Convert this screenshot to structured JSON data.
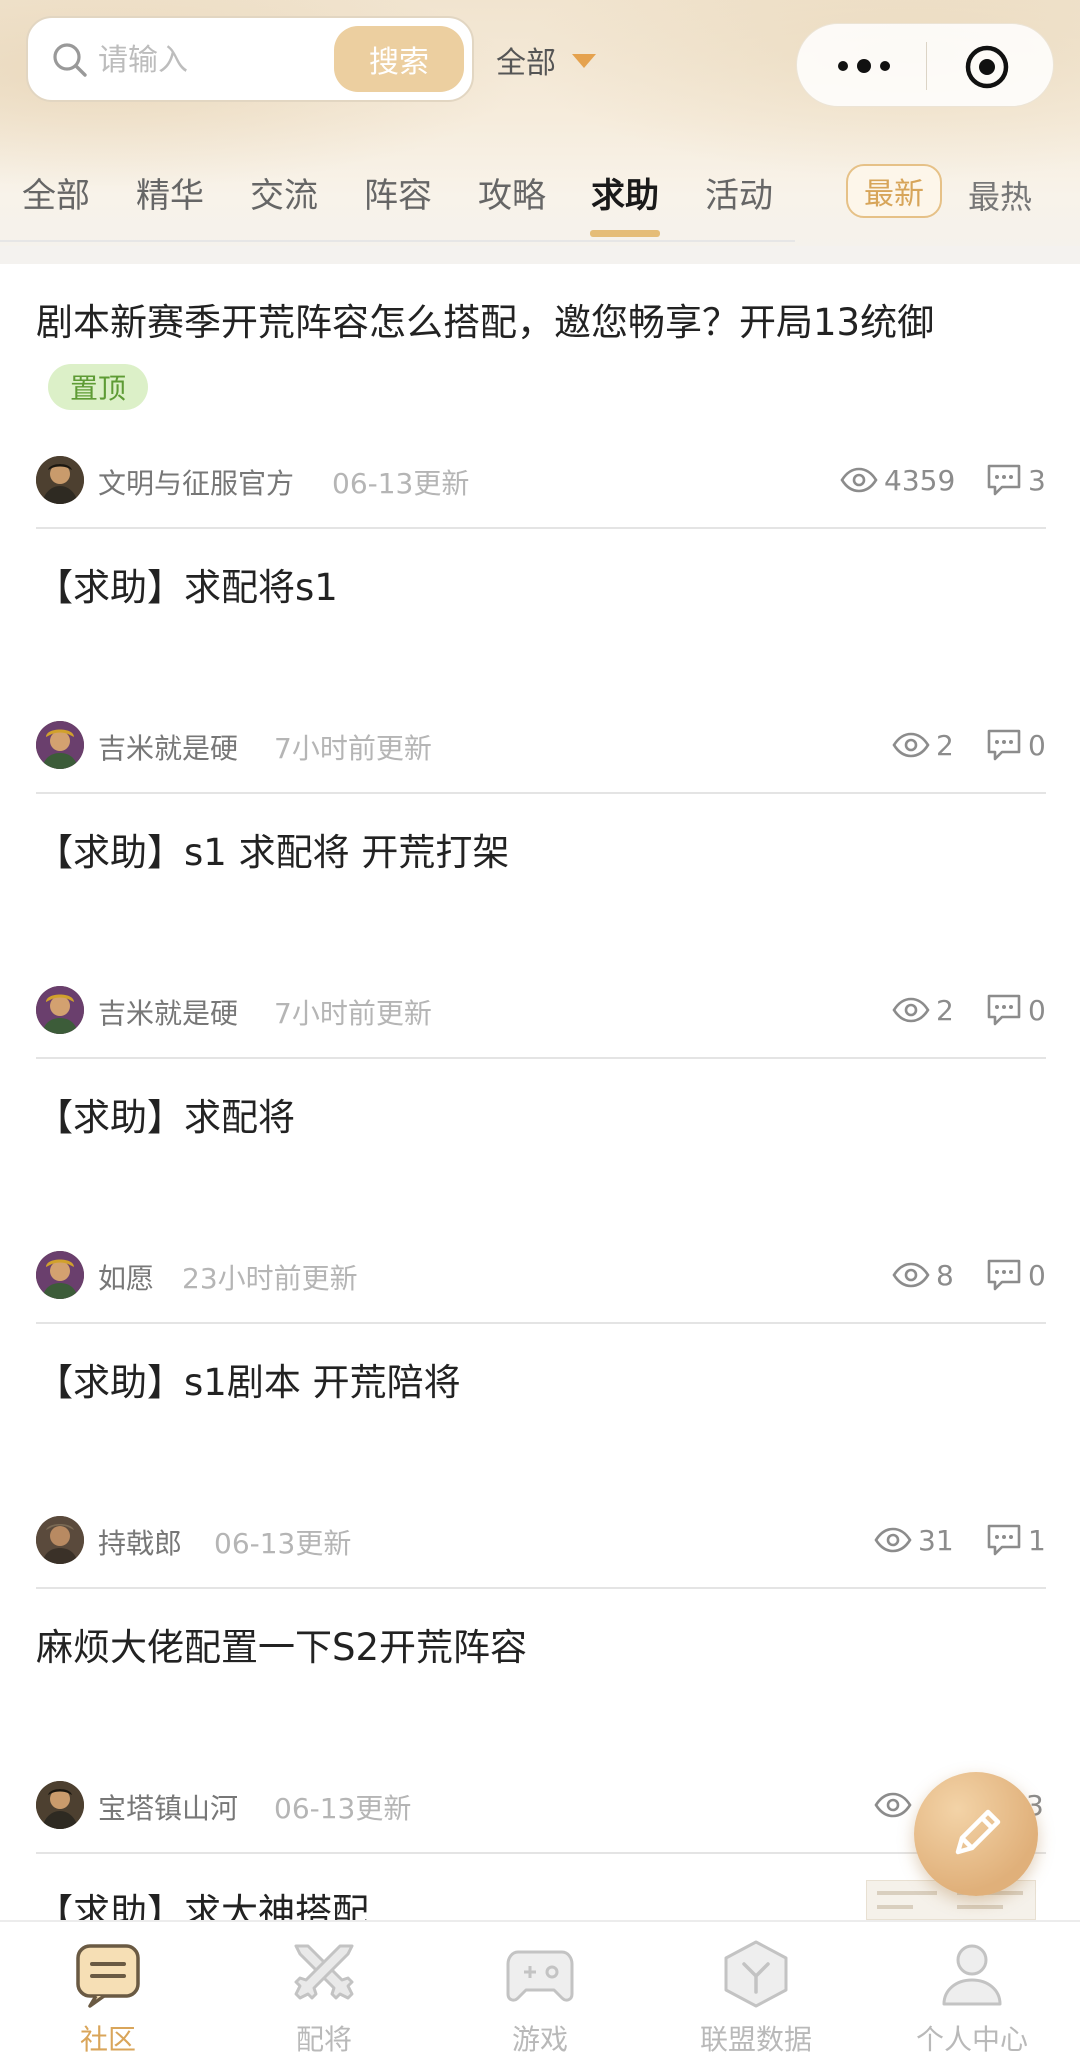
{
  "search": {
    "placeholder": "请输入",
    "button_label": "搜索",
    "scope_label": "全部"
  },
  "tabs": {
    "items": [
      {
        "label": "全部"
      },
      {
        "label": "精华"
      },
      {
        "label": "交流"
      },
      {
        "label": "阵容"
      },
      {
        "label": "攻略"
      },
      {
        "label": "求助"
      },
      {
        "label": "活动"
      }
    ],
    "active_index": 5
  },
  "sort": {
    "latest_label": "最新",
    "hot_label": "最热",
    "active": "latest"
  },
  "posts": [
    {
      "title": "剧本新赛季开荒阵容怎么搭配，邀您畅享？开局13统御",
      "badge": "置顶",
      "author": "文明与征服官方",
      "updated": "06-13更新",
      "views": "4359",
      "comments": "3"
    },
    {
      "title": "【求助】求配将s1",
      "author": "吉米就是硬",
      "updated": "7小时前更新",
      "views": "2",
      "comments": "0"
    },
    {
      "title": "【求助】s1 求配将 开荒打架",
      "author": "吉米就是硬",
      "updated": "7小时前更新",
      "views": "2",
      "comments": "0"
    },
    {
      "title": "【求助】求配将",
      "author": "如愿",
      "updated": "23小时前更新",
      "views": "8",
      "comments": "0"
    },
    {
      "title": "【求助】s1剧本 开荒陪将",
      "author": "持戟郎",
      "updated": "06-13更新",
      "views": "31",
      "comments": "1"
    },
    {
      "title": "麻烦大佬配置一下S2开荒阵容",
      "author": "宝塔镇山河",
      "updated": "06-13更新",
      "views": "",
      "comments": "3"
    },
    {
      "title": "【求助】求大神搭配"
    }
  ],
  "bottom_nav": {
    "items": [
      {
        "label": "社区",
        "icon": "community-icon"
      },
      {
        "label": "配将",
        "icon": "crossed-swords-icon"
      },
      {
        "label": "游戏",
        "icon": "gamepad-icon"
      },
      {
        "label": "联盟数据",
        "icon": "alliance-data-icon"
      },
      {
        "label": "个人中心",
        "icon": "user-icon"
      }
    ],
    "active_index": 0
  },
  "colors": {
    "accent": "#e5bd78",
    "accent_text": "#d9a55a",
    "search_button": "#eccfa0",
    "pin_badge_bg": "#dcf0c8",
    "pin_badge_text": "#5e9b35"
  }
}
